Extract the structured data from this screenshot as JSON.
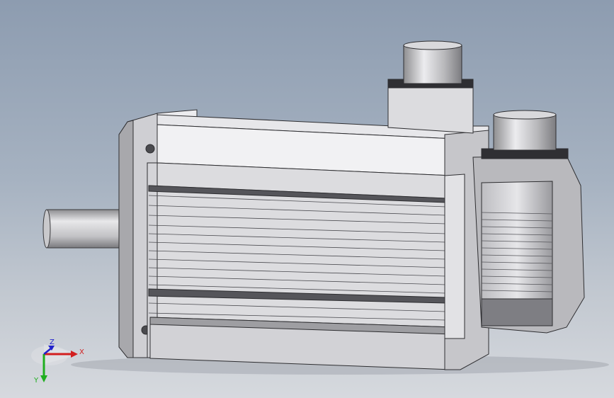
{
  "viewport": {
    "background_top": "#8d9cb0",
    "background_bottom": "#d6d9de",
    "model_color": "#dcdcdf"
  },
  "triad": {
    "x_label": "X",
    "y_label": "Y",
    "z_label": "Z",
    "x_color": "#d21f1f",
    "y_color": "#1fae1f",
    "z_color": "#2222cc"
  }
}
